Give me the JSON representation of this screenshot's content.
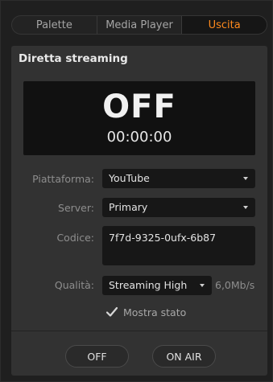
{
  "tabs": [
    {
      "label": "Palette",
      "active": false
    },
    {
      "label": "Media Player",
      "active": false
    },
    {
      "label": "Uscita",
      "active": true
    }
  ],
  "section": {
    "title": "Diretta streaming"
  },
  "status": {
    "state": "OFF",
    "timecode": "00:00:00"
  },
  "form": {
    "platform_label": "Piattaforma:",
    "platform_value": "YouTube",
    "server_label": "Server:",
    "server_value": "Primary",
    "key_label": "Codice:",
    "key_value": "7f7d-9325-0ufx-6b87",
    "quality_label": "Qualità:",
    "quality_value": "Streaming High",
    "bitrate": "6,0Mb/s",
    "show_status_label": "Mostra stato",
    "show_status_checked": true
  },
  "buttons": {
    "off_label": "OFF",
    "onair_label": "ON AIR"
  },
  "colors": {
    "accent": "#ff8a1d",
    "panel": "#323232",
    "background": "#1f1f1f"
  }
}
